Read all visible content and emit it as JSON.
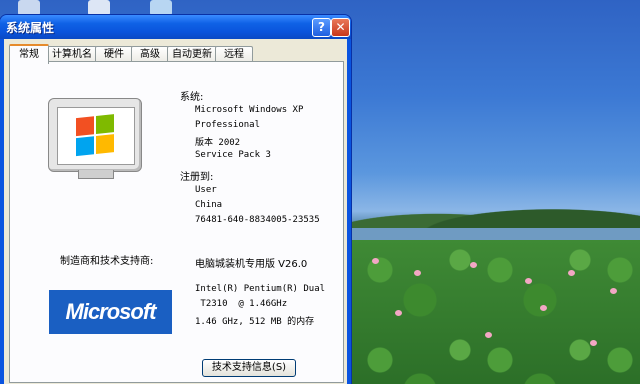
{
  "window": {
    "title": "系统属性",
    "help_glyph": "?",
    "close_glyph": "✕"
  },
  "tabs": [
    "常规",
    "计算机名",
    "硬件",
    "高级",
    "自动更新",
    "远程"
  ],
  "system": {
    "heading": "系统:",
    "lines": [
      "Microsoft Windows XP",
      "Professional",
      "版本 2002",
      "Service Pack 3"
    ]
  },
  "registered": {
    "heading": "注册到:",
    "lines": [
      "User",
      "China",
      "76481-640-8834005-23535"
    ]
  },
  "manufacturer": {
    "label": "制造商和技术支持商:",
    "edition": "电脑城装机专用版 V26.0",
    "cpu_lines": [
      "Intel(R) Pentium(R) Dual",
      " T2310  @ 1.46GHz",
      "1.46 GHz, 512 MB 的内存"
    ],
    "logo_text": "Microsoft"
  },
  "support_button": "技术支持信息(S)",
  "colors": {
    "titlebar": "#0a54e0",
    "tab_highlight": "#e68b2c",
    "logo_bg": "#1a5fc2"
  }
}
